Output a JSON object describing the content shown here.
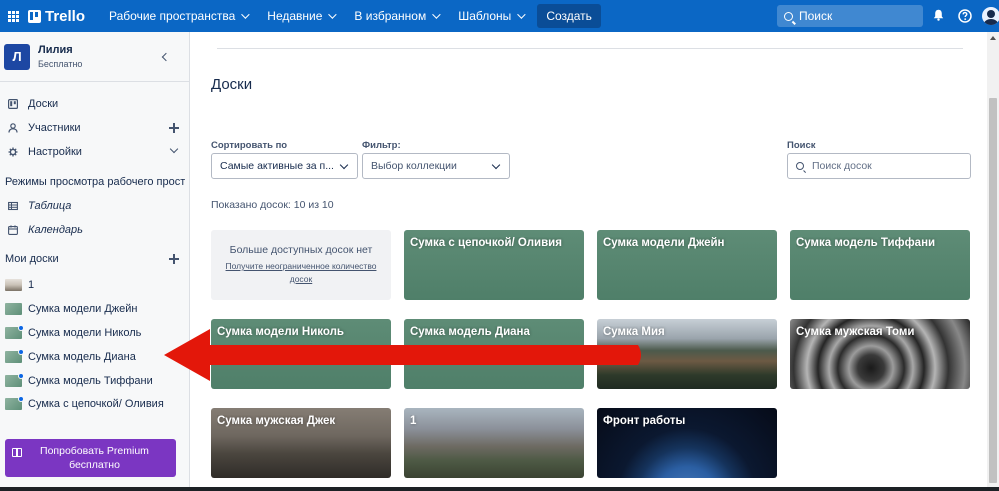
{
  "topbar": {
    "logo": "Trello",
    "nav": [
      {
        "label": "Рабочие пространства"
      },
      {
        "label": "Недавние"
      },
      {
        "label": "В избранном"
      },
      {
        "label": "Шаблоны"
      }
    ],
    "create_label": "Создать",
    "search_placeholder": "Поиск",
    "icons": [
      "apps-grid-icon",
      "bell-icon",
      "help-icon",
      "account-icon"
    ]
  },
  "workspace": {
    "avatar_letter": "Л",
    "name": "Лилия",
    "plan": "Бесплатно"
  },
  "sidebar": {
    "items": [
      {
        "label": "Доски",
        "icon": "board-icon"
      },
      {
        "label": "Участники",
        "icon": "person-icon"
      },
      {
        "label": "Настройки",
        "icon": "gear-icon"
      }
    ],
    "views_title": "Режимы просмотра рабочего пространства",
    "views": [
      {
        "label": "Таблица",
        "icon": "table-icon"
      },
      {
        "label": "Календарь",
        "icon": "calendar-icon"
      }
    ],
    "my_boards_title": "Мои доски",
    "boards": [
      {
        "label": "1",
        "thumb": "mountain"
      },
      {
        "label": "Сумка модели Джейн",
        "thumb": "green"
      },
      {
        "label": "Сумка модели Николь",
        "thumb": "green"
      },
      {
        "label": "Сумка модель Диана",
        "thumb": "green"
      },
      {
        "label": "Сумка модель Тиффани",
        "thumb": "green"
      },
      {
        "label": "Сумка с цепочкой/ Оливия",
        "thumb": "green"
      }
    ],
    "premium_line1": "Попробовать Premium",
    "premium_line2": "бесплатно"
  },
  "main": {
    "title": "Доски",
    "sort_label": "Сортировать по",
    "sort_value": "Самые активные за п...",
    "filter_label": "Фильтр:",
    "filter_value": "Выбор коллекции",
    "search_label": "Поиск",
    "search_placeholder": "Поиск досок",
    "shown_text": "Показано досок: 10 из 10",
    "empty_board_line1": "Больше доступных досок нет",
    "empty_board_link": "Получите неограниченное количество досок",
    "boards": [
      {
        "title": "Сумка с цепочкой/ Оливия",
        "bg": "green"
      },
      {
        "title": "Сумка модели Джейн",
        "bg": "green"
      },
      {
        "title": "Сумка модель Тиффани",
        "bg": "green"
      },
      {
        "title": "Сумка модели Николь",
        "bg": "green"
      },
      {
        "title": "Сумка модель Диана",
        "bg": "green"
      },
      {
        "title": "Сумка Мия",
        "bg": "village"
      },
      {
        "title": "Сумка мужская Томи",
        "bg": "spiral"
      },
      {
        "title": "Сумка мужская Джек",
        "bg": "dusk"
      },
      {
        "title": "1",
        "bg": "mountains"
      },
      {
        "title": "Фронт работы",
        "bg": "earth"
      }
    ]
  },
  "colors": {
    "topbar": "#0b67c5",
    "premium": "#7b36c2",
    "arrow": "#e3170a"
  }
}
